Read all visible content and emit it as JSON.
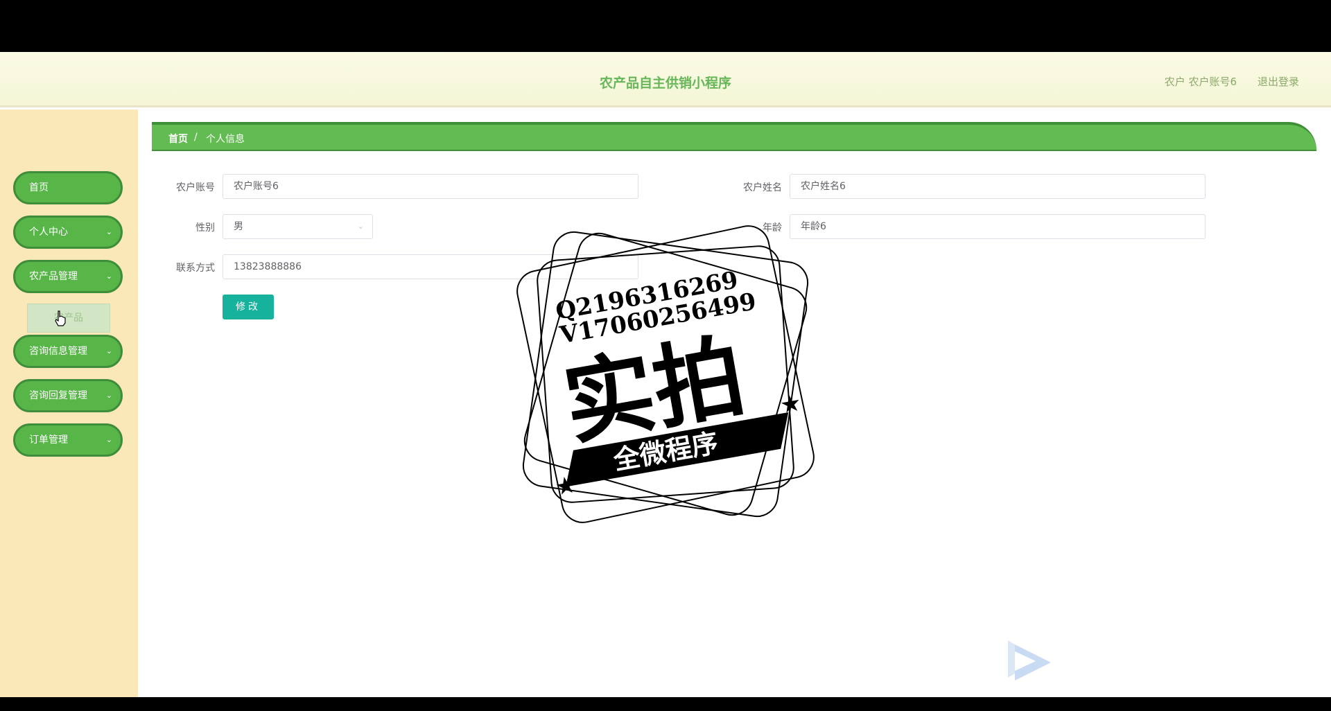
{
  "header": {
    "title": "农产品自主供销小程序",
    "user_info": "农户 农户账号6",
    "logout": "退出登录"
  },
  "sidebar": {
    "items": [
      {
        "label": "首页",
        "has_chevron": false
      },
      {
        "label": "个人中心",
        "has_chevron": true
      },
      {
        "label": "农产品管理",
        "has_chevron": true,
        "expanded": true
      },
      {
        "label": "咨询信息管理",
        "has_chevron": true
      },
      {
        "label": "咨询回复管理",
        "has_chevron": true
      },
      {
        "label": "订单管理",
        "has_chevron": true
      }
    ],
    "sub_item": "农产品",
    "chevron_icon": "chevron-down-icon"
  },
  "breadcrumb": {
    "home": "首页",
    "separator": "/",
    "current": "个人信息"
  },
  "form": {
    "account_label": "农户账号",
    "account_value": "农户账号6",
    "name_label": "农户姓名",
    "name_value": "农户姓名6",
    "gender_label": "性别",
    "gender_value": "男",
    "age_label": "年龄",
    "age_value": "年龄6",
    "contact_label": "联系方式",
    "contact_value": "13823888886",
    "submit_label": "修改"
  },
  "watermark": {
    "line1": "Q2196316269",
    "line2": "V17060256499",
    "main": "实拍",
    "banner": "全微程序"
  },
  "colors": {
    "accent": "#58b548",
    "button": "#16b29b",
    "sidebar_bg": "#fbe8b9",
    "title": "#67b65a"
  }
}
